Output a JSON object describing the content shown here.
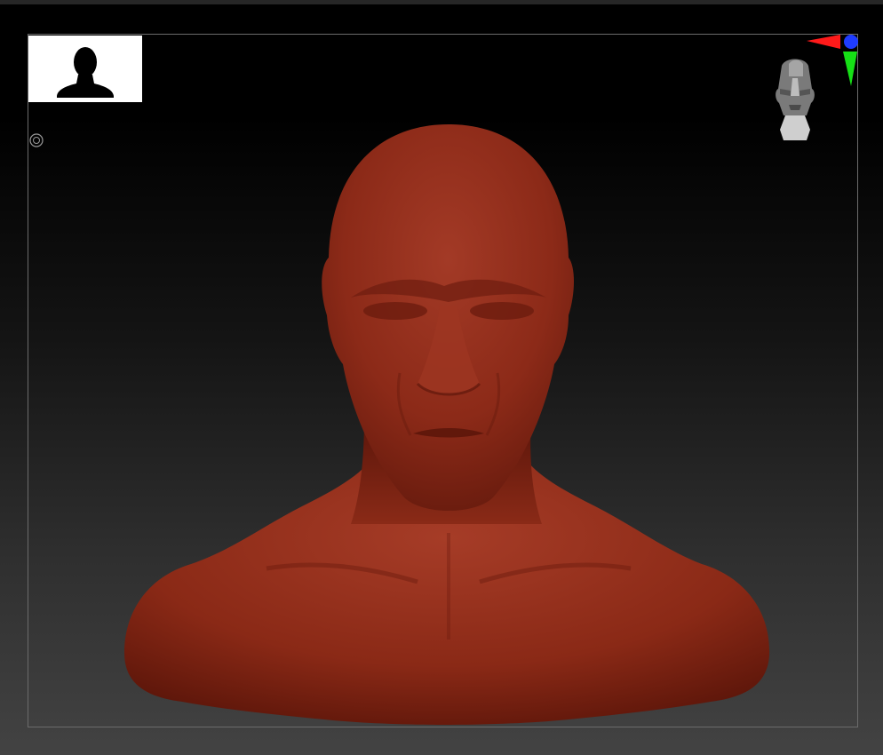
{
  "viewport": {
    "icons": {
      "thumbnail": "head-silhouette-icon",
      "pivot": "pivot-target-icon",
      "navigator": "navigation-head-icon",
      "axis_x": "x-axis-arrow-icon",
      "axis_y": "y-axis-arrow-icon",
      "axis_z": "z-axis-dot-icon"
    },
    "colors": {
      "axis_x": "#ff1a1a",
      "axis_y": "#16e016",
      "axis_z": "#1f3cff",
      "model": "#8f2a19",
      "frame": "#6b6b6b"
    }
  }
}
